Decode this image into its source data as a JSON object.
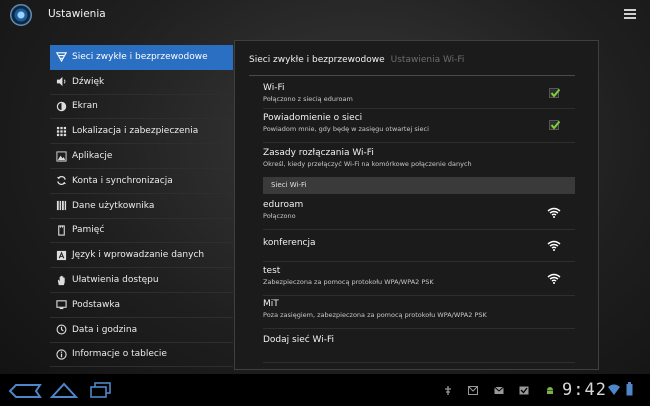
{
  "app": {
    "title": "Ustawienia"
  },
  "sidebar": {
    "items": [
      {
        "label": "Sieci zwykłe i bezprzewodowe",
        "icon": "wifi-icon",
        "active": true
      },
      {
        "label": "Dźwięk",
        "icon": "speaker-icon"
      },
      {
        "label": "Ekran",
        "icon": "brightness-icon"
      },
      {
        "label": "Lokalizacja i zabezpieczenia",
        "icon": "grid-lock-icon"
      },
      {
        "label": "Aplikacje",
        "icon": "apps-icon"
      },
      {
        "label": "Konta i synchronizacja",
        "icon": "sync-icon"
      },
      {
        "label": "Dane użytkownika",
        "icon": "data-icon"
      },
      {
        "label": "Pamięć",
        "icon": "storage-icon"
      },
      {
        "label": "Język i wprowadzanie danych",
        "icon": "language-icon"
      },
      {
        "label": "Ułatwienia dostępu",
        "icon": "hand-icon"
      },
      {
        "label": "Podstawka",
        "icon": "dock-icon"
      },
      {
        "label": "Data i godzina",
        "icon": "clock-icon"
      },
      {
        "label": "Informacje o tablecie",
        "icon": "info-icon"
      }
    ]
  },
  "panel": {
    "tab_active": "Sieci zwykłe i bezprzewodowe",
    "tab_inactive": "Ustawienia Wi-Fi",
    "settings": [
      {
        "title": "Wi-Fi",
        "subtitle": "Połączono z siecią eduroam",
        "checked": true
      },
      {
        "title": "Powiadomienie o sieci",
        "subtitle": "Powiadom mnie, gdy będę w zasięgu otwartej sieci",
        "checked": true
      },
      {
        "title": "Zasady rozłączania Wi-Fi",
        "subtitle": "Określ, kiedy przełączyć Wi-Fi na komórkowe połączenie danych"
      }
    ],
    "section_header": "Sieci Wi-Fi",
    "networks": [
      {
        "title": "eduroam",
        "subtitle": "Połączono",
        "icon": "wifi-locked-icon"
      },
      {
        "title": "konferencja",
        "subtitle": "",
        "icon": "wifi-icon"
      },
      {
        "title": "test",
        "subtitle": "Zabezpieczona za pomocą protokołu WPA/WPA2 PSK",
        "icon": "wifi-locked-icon"
      },
      {
        "title": "MiT",
        "subtitle": "Poza zasięgiem, zabezpieczona za pomocą protokołu WPA/WPA2 PSK"
      },
      {
        "title": "Dodaj sieć Wi-Fi",
        "subtitle": ""
      }
    ]
  },
  "statusbar": {
    "time": "9:42",
    "icons": [
      "usb-debug-icon",
      "gmail-icon",
      "mail-icon",
      "download-done-icon",
      "android-icon",
      "wifi-icon",
      "battery-icon"
    ]
  },
  "colors": {
    "accent": "#2a6fc2",
    "check": "#7bd23a"
  }
}
